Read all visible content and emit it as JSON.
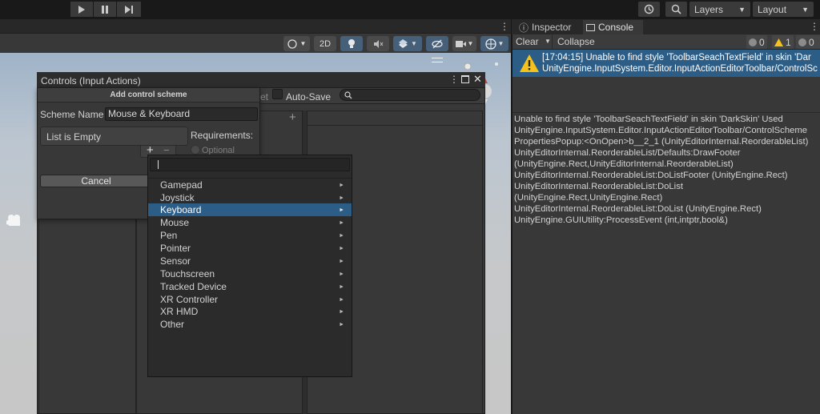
{
  "toolbar": {
    "play_icon": "play-icon",
    "pause_icon": "pause-icon",
    "step_icon": "step-icon",
    "layers_label": "Layers",
    "layout_label": "Layout"
  },
  "scene_toolbar": {
    "mode_2d": "2D"
  },
  "input_actions": {
    "title": "Controls (Input Actions)",
    "auto_save_label": "Auto-Save",
    "partial_label": "et",
    "add_icon": "+"
  },
  "add_scheme": {
    "header": "Add control scheme",
    "scheme_name_label": "Scheme Name",
    "scheme_name_value": "Mouse & Keyboard",
    "list_empty": "List is Empty",
    "requirements_label": "Requirements:",
    "optional_label": "Optional",
    "add": "+",
    "remove": "−",
    "cancel_label": "Cancel"
  },
  "device_menu": {
    "items": [
      {
        "label": "Gamepad"
      },
      {
        "label": "Joystick"
      },
      {
        "label": "Keyboard"
      },
      {
        "label": "Mouse"
      },
      {
        "label": "Pen"
      },
      {
        "label": "Pointer"
      },
      {
        "label": "Sensor"
      },
      {
        "label": "Touchscreen"
      },
      {
        "label": "Tracked Device"
      },
      {
        "label": "XR Controller"
      },
      {
        "label": "XR HMD"
      },
      {
        "label": "Other"
      }
    ],
    "selected": "Keyboard"
  },
  "right_panel": {
    "tab_inspector": "Inspector",
    "tab_console": "Console",
    "clear_label": "Clear",
    "collapse_label": "Collapse",
    "info_count": "0",
    "warn_count": "1",
    "error_count": "0",
    "log_line1": "[17:04:15] Unable to find style 'ToolbarSeachTextField' in skin 'Dar",
    "log_line2": "UnityEngine.InputSystem.Editor.InputActionEditorToolbar/ControlSc",
    "detail": [
      "Unable to find style 'ToolbarSeachTextField' in skin 'DarkSkin' Used",
      "UnityEngine.InputSystem.Editor.InputActionEditorToolbar/ControlScheme",
      "PropertiesPopup:<OnOpen>b__2_1 (UnityEditorInternal.ReorderableList)",
      "UnityEditorInternal.ReorderableList/Defaults:DrawFooter",
      "(UnityEngine.Rect,UnityEditorInternal.ReorderableList)",
      "UnityEditorInternal.ReorderableList:DoListFooter (UnityEngine.Rect)",
      "UnityEditorInternal.ReorderableList:DoList",
      "(UnityEngine.Rect,UnityEngine.Rect)",
      "UnityEditorInternal.ReorderableList:DoList (UnityEngine.Rect)",
      "UnityEngine.GUIUtility:ProcessEvent (int,intptr,bool&)"
    ]
  },
  "colors": {
    "selection_blue": "#2c5d87",
    "warning_yellow": "#f4c21a"
  }
}
